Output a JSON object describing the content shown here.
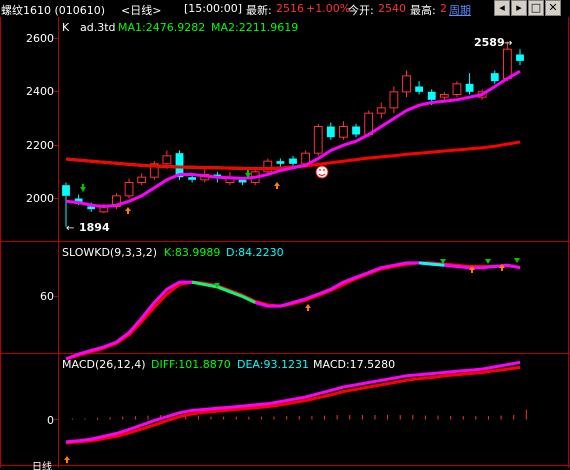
{
  "topbar": {
    "symbol": "螺纹1610 (010610)",
    "period": "<日线>",
    "time": "[15:00:00]",
    "latest_label": "最新:",
    "latest_value": "2516",
    "change": "+1.00%",
    "open_label": "今开:",
    "open_value": "2540",
    "high_label": "最高:",
    "high_value": "2",
    "cycle_label": "周期",
    "btn_left_icon": "arrow-left-icon",
    "btn_right_icon": "arrow-right-icon",
    "btn_max_icon": "maximize-icon",
    "btn_close_icon": "close-icon"
  },
  "colors": {
    "up": "#ff3232",
    "down": "#00ffff",
    "ma1": "#ff00ff",
    "ma2": "#ff0000",
    "ma_long": "#00ff00",
    "axis": "#b40000",
    "kdj_k": "#ff00ff",
    "kdj_d": "#ff0000",
    "kdj_flat": "#00ff66",
    "diff": "#ff00ff",
    "dea": "#ff0000"
  },
  "main_panel": {
    "title": "K",
    "indicator": "ad.3td",
    "ma1_label": "MA1:2476.9282",
    "ma2_label": "MA2:2211.9619",
    "yticks": [
      "2600",
      "2400",
      "2200",
      "2000"
    ],
    "high_marker": "2589",
    "low_marker": "1894"
  },
  "kd_panel": {
    "title": "SLOWKD(9,3,3,2)",
    "k_label": "K:83.9989",
    "d_label": "D:84.2230",
    "yticks": [
      "60"
    ]
  },
  "macd_panel": {
    "title": "MACD(26,12,4)",
    "diff_label": "DIFF:101.8870",
    "dea_label": "DEA:93.1231",
    "macd_label": "MACD:17.5280",
    "yticks": [
      "0"
    ]
  },
  "bottom_axis": {
    "date_label": "日线"
  },
  "chart_data": [
    {
      "type": "candlestick",
      "yticks": [
        2000,
        2200,
        2400,
        2600
      ],
      "ylim": [
        1880,
        2650
      ],
      "candles": [
        {
          "o": 2010,
          "c": 2050,
          "h": 2060,
          "l": 1894,
          "dir": "down"
        },
        {
          "o": 1980,
          "c": 2000,
          "h": 2015,
          "l": 1975,
          "dir": "down"
        },
        {
          "o": 1960,
          "c": 1970,
          "h": 1985,
          "l": 1950,
          "dir": "down"
        },
        {
          "o": 1950,
          "c": 1970,
          "h": 1980,
          "l": 1945,
          "dir": "up"
        },
        {
          "o": 1970,
          "c": 2010,
          "h": 2020,
          "l": 1960,
          "dir": "up"
        },
        {
          "o": 2010,
          "c": 2060,
          "h": 2075,
          "l": 2000,
          "dir": "up"
        },
        {
          "o": 2060,
          "c": 2080,
          "h": 2095,
          "l": 2050,
          "dir": "up"
        },
        {
          "o": 2080,
          "c": 2130,
          "h": 2140,
          "l": 2070,
          "dir": "up"
        },
        {
          "o": 2130,
          "c": 2160,
          "h": 2180,
          "l": 2110,
          "dir": "up"
        },
        {
          "o": 2170,
          "c": 2080,
          "h": 2180,
          "l": 2070,
          "dir": "down"
        },
        {
          "o": 2080,
          "c": 2070,
          "h": 2090,
          "l": 2060,
          "dir": "down"
        },
        {
          "o": 2070,
          "c": 2090,
          "h": 2110,
          "l": 2060,
          "dir": "up"
        },
        {
          "o": 2090,
          "c": 2080,
          "h": 2100,
          "l": 2060,
          "dir": "down"
        },
        {
          "o": 2080,
          "c": 2060,
          "h": 2100,
          "l": 2050,
          "dir": "up"
        },
        {
          "o": 2070,
          "c": 2060,
          "h": 2080,
          "l": 2050,
          "dir": "down"
        },
        {
          "o": 2060,
          "c": 2100,
          "h": 2110,
          "l": 2050,
          "dir": "up"
        },
        {
          "o": 2100,
          "c": 2140,
          "h": 2150,
          "l": 2090,
          "dir": "up"
        },
        {
          "o": 2140,
          "c": 2130,
          "h": 2150,
          "l": 2120,
          "dir": "down"
        },
        {
          "o": 2150,
          "c": 2130,
          "h": 2160,
          "l": 2120,
          "dir": "down"
        },
        {
          "o": 2130,
          "c": 2170,
          "h": 2180,
          "l": 2125,
          "dir": "up"
        },
        {
          "o": 2170,
          "c": 2270,
          "h": 2280,
          "l": 2160,
          "dir": "up"
        },
        {
          "o": 2270,
          "c": 2230,
          "h": 2285,
          "l": 2220,
          "dir": "down"
        },
        {
          "o": 2230,
          "c": 2270,
          "h": 2290,
          "l": 2220,
          "dir": "up"
        },
        {
          "o": 2270,
          "c": 2240,
          "h": 2280,
          "l": 2230,
          "dir": "down"
        },
        {
          "o": 2240,
          "c": 2320,
          "h": 2330,
          "l": 2230,
          "dir": "up"
        },
        {
          "o": 2320,
          "c": 2340,
          "h": 2360,
          "l": 2300,
          "dir": "up"
        },
        {
          "o": 2340,
          "c": 2400,
          "h": 2420,
          "l": 2320,
          "dir": "up"
        },
        {
          "o": 2400,
          "c": 2460,
          "h": 2480,
          "l": 2380,
          "dir": "up"
        },
        {
          "o": 2420,
          "c": 2400,
          "h": 2440,
          "l": 2390,
          "dir": "down"
        },
        {
          "o": 2400,
          "c": 2370,
          "h": 2410,
          "l": 2350,
          "dir": "down"
        },
        {
          "o": 2380,
          "c": 2390,
          "h": 2400,
          "l": 2360,
          "dir": "up"
        },
        {
          "o": 2390,
          "c": 2430,
          "h": 2440,
          "l": 2380,
          "dir": "up"
        },
        {
          "o": 2430,
          "c": 2400,
          "h": 2470,
          "l": 2390,
          "dir": "down"
        },
        {
          "o": 2400,
          "c": 2380,
          "h": 2410,
          "l": 2370,
          "dir": "up"
        },
        {
          "o": 2440,
          "c": 2470,
          "h": 2480,
          "l": 2430,
          "dir": "down"
        },
        {
          "o": 2450,
          "c": 2560,
          "h": 2589,
          "l": 2440,
          "dir": "up"
        },
        {
          "o": 2540,
          "c": 2516,
          "h": 2560,
          "l": 2500,
          "dir": "down"
        }
      ],
      "ma1": [
        1990,
        1985,
        1975,
        1970,
        1975,
        1990,
        2010,
        2040,
        2070,
        2090,
        2090,
        2085,
        2080,
        2078,
        2075,
        2080,
        2090,
        2105,
        2115,
        2125,
        2150,
        2180,
        2200,
        2215,
        2240,
        2270,
        2300,
        2330,
        2350,
        2360,
        2365,
        2370,
        2380,
        2390,
        2420,
        2450,
        2476.9282
      ],
      "ma2": [
        2148,
        2144,
        2140,
        2136,
        2132,
        2128,
        2124,
        2122,
        2120,
        2118,
        2117,
        2116,
        2115,
        2114,
        2113,
        2112,
        2112,
        2114,
        2118,
        2122,
        2128,
        2134,
        2140,
        2146,
        2152,
        2156,
        2160,
        2166,
        2170,
        2174,
        2178,
        2182,
        2186,
        2190,
        2196,
        2204,
        2211.9619
      ],
      "ma_long": [
        2148,
        2144,
        2140,
        2136,
        2132,
        2128,
        2124,
        2122,
        2120,
        2118,
        2117,
        2116,
        2115,
        2114,
        2113,
        2112,
        2112,
        2114,
        2118
      ]
    },
    {
      "type": "line",
      "series": [
        {
          "name": "K",
          "values": [
            8,
            12,
            15,
            18,
            22,
            30,
            42,
            55,
            66,
            72,
            72,
            70,
            68,
            64,
            60,
            55,
            52,
            52,
            55,
            58,
            62,
            66,
            72,
            76,
            80,
            84,
            86,
            88,
            88,
            87,
            86,
            85,
            84,
            84,
            85,
            86,
            83.9989
          ]
        },
        {
          "name": "D",
          "values": [
            8,
            11,
            14,
            17,
            21,
            28,
            39,
            51,
            62,
            70,
            72,
            71,
            69,
            65,
            61,
            56,
            53,
            52,
            54,
            57,
            61,
            65,
            70,
            75,
            79,
            83,
            85,
            87,
            88,
            88,
            87,
            86,
            85,
            85,
            85,
            86,
            84.223
          ]
        }
      ],
      "ylim": [
        0,
        100
      ],
      "yticks": [
        60
      ]
    },
    {
      "type": "line",
      "series": [
        {
          "name": "DIFF",
          "values": [
            -40,
            -38,
            -35,
            -30,
            -25,
            -18,
            -10,
            -2,
            5,
            12,
            16,
            18,
            20,
            22,
            24,
            26,
            28,
            32,
            36,
            40,
            46,
            52,
            58,
            62,
            66,
            70,
            74,
            78,
            80,
            82,
            84,
            86,
            88,
            90,
            94,
            98,
            101.887
          ]
        },
        {
          "name": "DEA",
          "values": [
            -42,
            -40,
            -38,
            -34,
            -30,
            -24,
            -17,
            -10,
            -2,
            5,
            10,
            13,
            15,
            17,
            19,
            21,
            23,
            26,
            30,
            34,
            39,
            44,
            50,
            54,
            58,
            62,
            66,
            70,
            73,
            75,
            78,
            80,
            82,
            84,
            87,
            90,
            93.1231
          ]
        }
      ],
      "macd": [
        2,
        2,
        3,
        4,
        5,
        6,
        7,
        8,
        7,
        7,
        6,
        5,
        5,
        5,
        5,
        5,
        5,
        6,
        6,
        6,
        7,
        8,
        8,
        8,
        8,
        8,
        8,
        8,
        7,
        7,
        6,
        6,
        6,
        6,
        7,
        8,
        17.528
      ],
      "ylim": [
        -45,
        110
      ],
      "yticks": [
        0
      ]
    }
  ]
}
